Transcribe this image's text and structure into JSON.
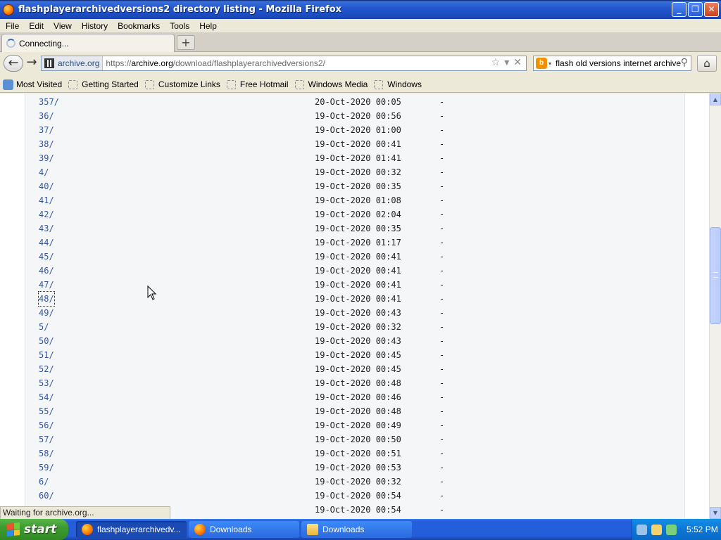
{
  "window": {
    "title": "flashplayerarchivedversions2 directory listing - Mozilla Firefox",
    "buttons": {
      "minimize": "_",
      "maximize": "❐",
      "close": "✕"
    }
  },
  "menu": [
    "File",
    "Edit",
    "View",
    "History",
    "Bookmarks",
    "Tools",
    "Help"
  ],
  "tab": {
    "label": "Connecting...",
    "new_tab": "+"
  },
  "navigation": {
    "identity": "archive.org",
    "url_prefix": "https://",
    "url_host": "archive.org",
    "url_path": "/download/flashplayerarchivedversions2/",
    "star": "☆",
    "dropdown": "▾",
    "stop": "✕",
    "search_text": "flash old versions internet archive",
    "search_glass": "⚲",
    "home": "⌂",
    "back": "←",
    "forward": "→"
  },
  "bookmarks": [
    "Most Visited",
    "Getting Started",
    "Customize Links",
    "Free Hotmail",
    "Windows Media",
    "Windows"
  ],
  "listing": [
    {
      "name": "357/",
      "date": "20-Oct-2020 00:05",
      "size": "-"
    },
    {
      "name": "36/",
      "date": "19-Oct-2020 00:56",
      "size": "-"
    },
    {
      "name": "37/",
      "date": "19-Oct-2020 01:00",
      "size": "-"
    },
    {
      "name": "38/",
      "date": "19-Oct-2020 00:41",
      "size": "-"
    },
    {
      "name": "39/",
      "date": "19-Oct-2020 01:41",
      "size": "-"
    },
    {
      "name": "4/",
      "date": "19-Oct-2020 00:32",
      "size": "-"
    },
    {
      "name": "40/",
      "date": "19-Oct-2020 00:35",
      "size": "-"
    },
    {
      "name": "41/",
      "date": "19-Oct-2020 01:08",
      "size": "-"
    },
    {
      "name": "42/",
      "date": "19-Oct-2020 02:04",
      "size": "-"
    },
    {
      "name": "43/",
      "date": "19-Oct-2020 00:35",
      "size": "-"
    },
    {
      "name": "44/",
      "date": "19-Oct-2020 01:17",
      "size": "-"
    },
    {
      "name": "45/",
      "date": "19-Oct-2020 00:41",
      "size": "-"
    },
    {
      "name": "46/",
      "date": "19-Oct-2020 00:41",
      "size": "-"
    },
    {
      "name": "47/",
      "date": "19-Oct-2020 00:41",
      "size": "-"
    },
    {
      "name": "48/",
      "date": "19-Oct-2020 00:41",
      "size": "-"
    },
    {
      "name": "49/",
      "date": "19-Oct-2020 00:43",
      "size": "-"
    },
    {
      "name": "5/",
      "date": "19-Oct-2020 00:32",
      "size": "-"
    },
    {
      "name": "50/",
      "date": "19-Oct-2020 00:43",
      "size": "-"
    },
    {
      "name": "51/",
      "date": "19-Oct-2020 00:45",
      "size": "-"
    },
    {
      "name": "52/",
      "date": "19-Oct-2020 00:45",
      "size": "-"
    },
    {
      "name": "53/",
      "date": "19-Oct-2020 00:48",
      "size": "-"
    },
    {
      "name": "54/",
      "date": "19-Oct-2020 00:46",
      "size": "-"
    },
    {
      "name": "55/",
      "date": "19-Oct-2020 00:48",
      "size": "-"
    },
    {
      "name": "56/",
      "date": "19-Oct-2020 00:49",
      "size": "-"
    },
    {
      "name": "57/",
      "date": "19-Oct-2020 00:50",
      "size": "-"
    },
    {
      "name": "58/",
      "date": "19-Oct-2020 00:51",
      "size": "-"
    },
    {
      "name": "59/",
      "date": "19-Oct-2020 00:53",
      "size": "-"
    },
    {
      "name": "6/",
      "date": "19-Oct-2020 00:32",
      "size": "-"
    },
    {
      "name": "60/",
      "date": "19-Oct-2020 00:54",
      "size": "-"
    },
    {
      "name": "",
      "date": "19-Oct-2020 00:54",
      "size": "-"
    }
  ],
  "focused_item": "48/",
  "status": "Waiting for archive.org...",
  "taskbar": {
    "start": "start",
    "tasks": [
      {
        "label": "flashplayerarchivedv...",
        "icon": "firefox-icon",
        "active": true
      },
      {
        "label": "Downloads",
        "icon": "firefox-icon",
        "active": false
      },
      {
        "label": "Downloads",
        "icon": "folder-icon",
        "active": false
      }
    ],
    "clock": "5:52 PM"
  },
  "colors": {
    "link": "#3355a8",
    "listing_bg": "#f5f6f7",
    "taskbar": "#245edb",
    "start_green": "#3d9c2f"
  }
}
